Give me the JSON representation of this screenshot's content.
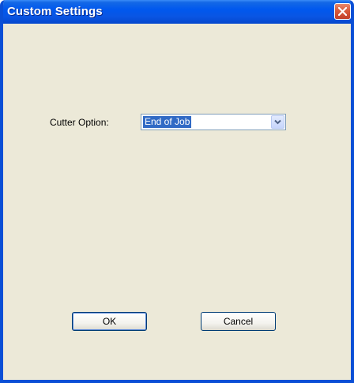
{
  "window": {
    "title": "Custom Settings"
  },
  "form": {
    "cutter_option_label": "Cutter Option:",
    "cutter_option_value": "End of Job"
  },
  "buttons": {
    "ok_label": "OK",
    "cancel_label": "Cancel"
  },
  "icons": {
    "close": "close-icon",
    "dropdown": "chevron-down-icon"
  },
  "colors": {
    "titlebar": "#0058ee",
    "dialog_bg": "#ece9d8",
    "selection": "#316ac5",
    "close_button": "#d85a3a"
  }
}
